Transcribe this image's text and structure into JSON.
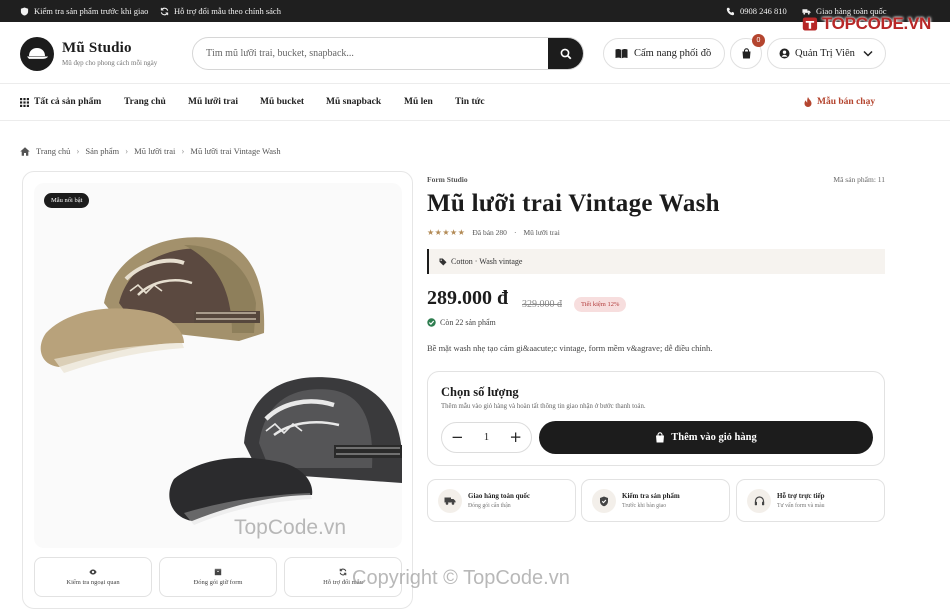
{
  "topbar": {
    "left_items": [
      {
        "icon": "shield-icon",
        "label": "Kiểm tra sản phẩm trước khi giao"
      },
      {
        "icon": "refresh-icon",
        "label": "Hỗ trợ đổi mẫu theo chính sách"
      }
    ],
    "phone": "0908 246 810",
    "shipping": "Giao hàng toàn quốc"
  },
  "header": {
    "logo_title": "Mũ Studio",
    "logo_subtitle": "Mũ đẹp cho phong cách mỗi ngày",
    "search_placeholder": "Tìm mũ lưỡi trai, bucket, snapback...",
    "guide_label": "Cẩm nang phối đồ",
    "cart_count": "0",
    "user_label": "Quản Trị Viên"
  },
  "nav": {
    "all_products": "Tất cả sản phẩm",
    "items": [
      "Trang chủ",
      "Mũ lưỡi trai",
      "Mũ bucket",
      "Mũ snapback",
      "Mũ len",
      "Tin tức"
    ],
    "bestseller": "Mẫu bán chạy"
  },
  "breadcrumb": [
    "Trang chủ",
    "Sản phẩm",
    "Mũ lưỡi trai",
    "Mũ lưỡi trai Vintage Wash"
  ],
  "gallery": {
    "featured_tag": "Mẫu nổi bật",
    "thumbs": [
      {
        "icon": "eye-icon",
        "label": "Kiểm tra ngoại quan"
      },
      {
        "icon": "box-icon",
        "label": "Đóng gói giữ form"
      },
      {
        "icon": "refresh-icon",
        "label": "Hỗ trợ đổi mẫu"
      }
    ]
  },
  "product": {
    "brand": "Form Studio",
    "sku": "Mã sản phẩm: 11",
    "title": "Mũ lưỡi trai Vintage Wash",
    "rating": 5,
    "sold": "Đã bán 280",
    "category": "Mũ lưỡi trai",
    "material": "Cotton · Wash vintage",
    "price": "289.000 đ",
    "old_price": "329.000 đ",
    "saving": "Tiết kiệm 12%",
    "stock": "Còn 22 sản phẩm",
    "description": "Bề mặt wash nhẹ tạo cảm gi&aacute;c vintage, form mềm v&agrave; dễ điều chỉnh."
  },
  "quantity": {
    "title": "Chọn số lượng",
    "subtitle": "Thêm mẫu vào giỏ hàng và hoàn tất thông tin giao nhận ở bước thanh toán.",
    "value": "1",
    "minus": "−",
    "plus": "+",
    "add_to_cart": "Thêm vào giỏ hàng"
  },
  "features": [
    {
      "icon": "truck-icon",
      "title": "Giao hàng toàn quốc",
      "subtitle": "Đóng gói cẩn thận"
    },
    {
      "icon": "shield-check-icon",
      "title": "Kiểm tra sản phẩm",
      "subtitle": "Trước khi bàn giao"
    },
    {
      "icon": "headset-icon",
      "title": "Hỗ trợ trực tiếp",
      "subtitle": "Tư vấn form và màu"
    }
  ],
  "watermarks": {
    "logo_text": "TOPCODE.VN",
    "photo_text": "TopCode.vn",
    "copyright": "Copyright © TopCode.vn"
  },
  "colors": {
    "dark": "#1c1c1c",
    "accent": "#b4452f",
    "sale_bg": "#f7dede",
    "in_stock": "#2e7d4f",
    "star": "#b28a55"
  }
}
